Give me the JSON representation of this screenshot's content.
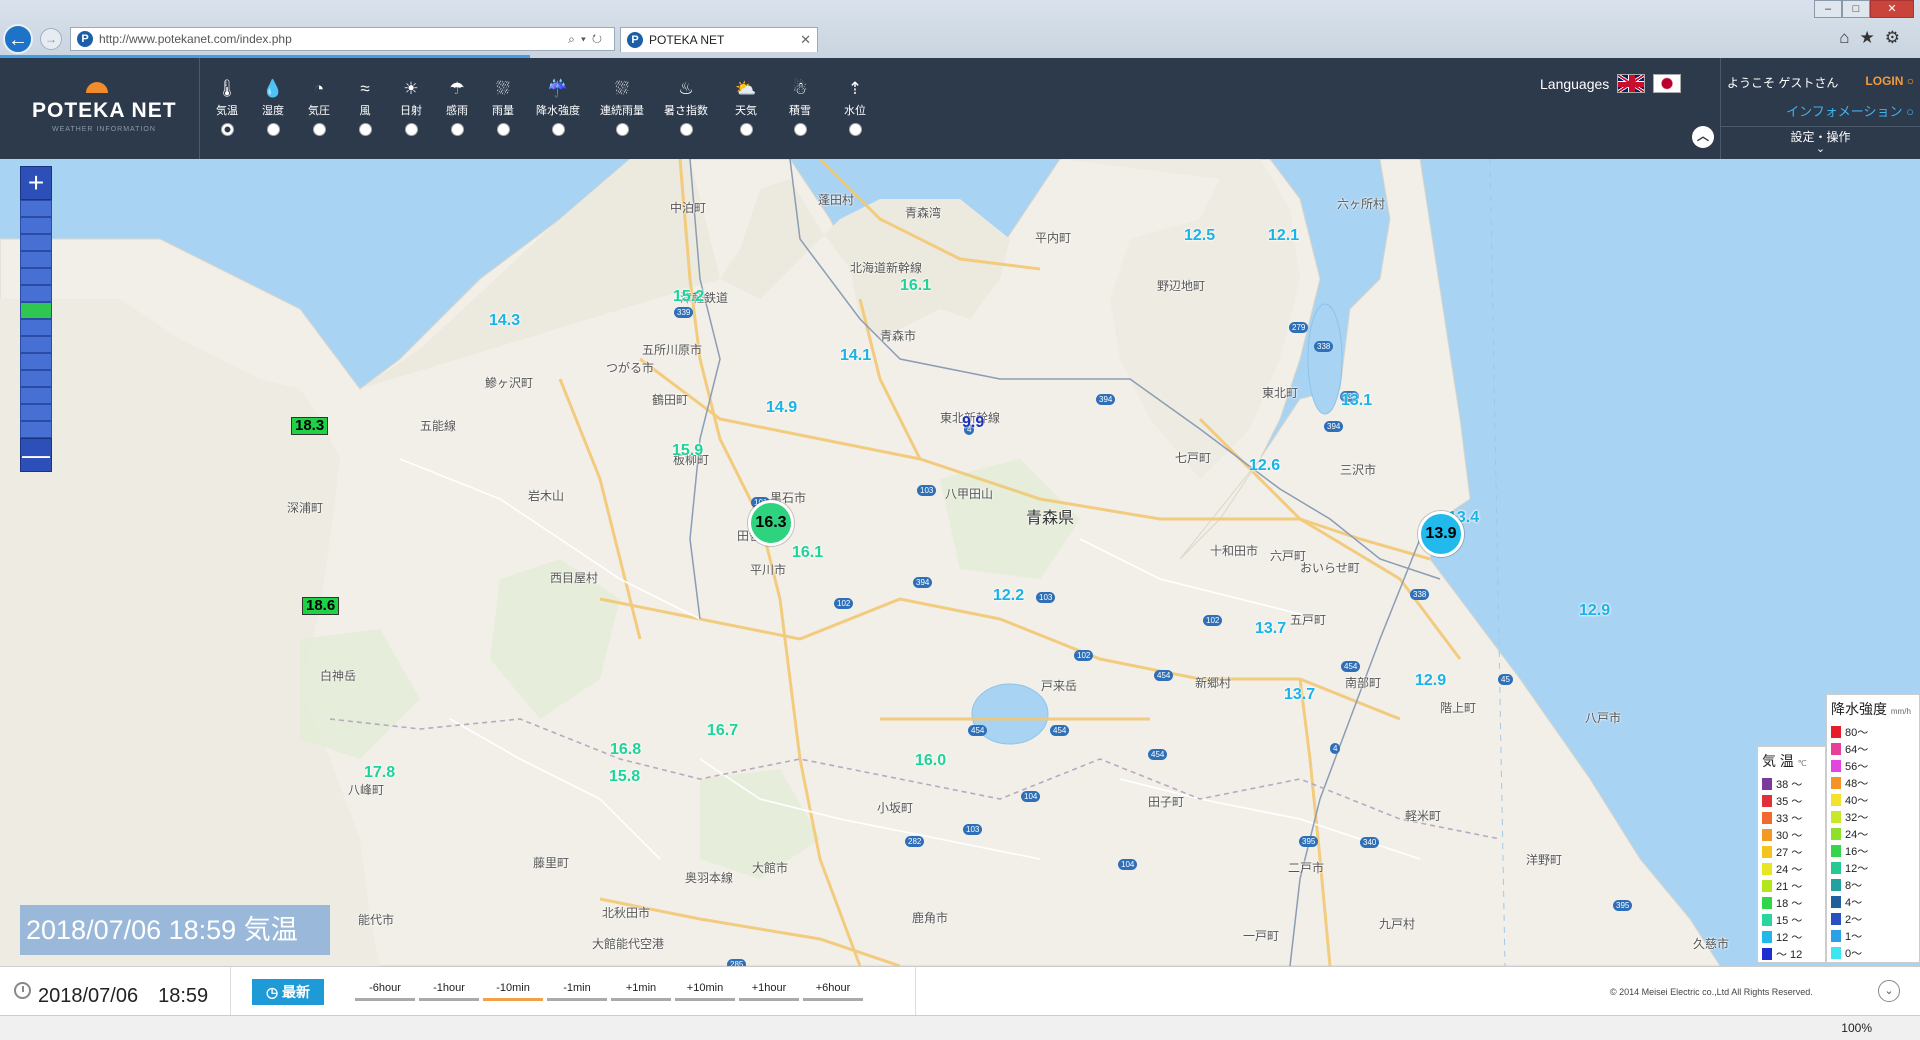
{
  "browser": {
    "url": "http://www.potekanet.com/index.php",
    "tab_title": "POTEKA NET",
    "favicon_letter": "P",
    "zoom_level": "100%"
  },
  "header": {
    "logo_title": "POTEKA NET",
    "logo_subtitle": "WEATHER INFORMATION",
    "layers": [
      {
        "label": "気温",
        "icon": "thermometer-icon",
        "glyph": "🌡",
        "selected": true
      },
      {
        "label": "湿度",
        "icon": "humidity-icon",
        "glyph": "💧",
        "selected": false
      },
      {
        "label": "気圧",
        "icon": "pressure-icon",
        "glyph": "◔",
        "selected": false
      },
      {
        "label": "風",
        "icon": "wind-icon",
        "glyph": "≈",
        "selected": false
      },
      {
        "label": "日射",
        "icon": "sun-icon",
        "glyph": "☀",
        "selected": false
      },
      {
        "label": "感雨",
        "icon": "umbrella-icon",
        "glyph": "☂",
        "selected": false
      },
      {
        "label": "雨量",
        "icon": "rain-gauge-icon",
        "glyph": "⛆",
        "selected": false
      },
      {
        "label": "降水強度",
        "icon": "rain-intensity-icon",
        "glyph": "☔",
        "selected": false
      },
      {
        "label": "連続雨量",
        "icon": "continuous-rain-icon",
        "glyph": "⛆",
        "selected": false
      },
      {
        "label": "暑さ指数",
        "icon": "heat-index-icon",
        "glyph": "♨",
        "selected": false
      },
      {
        "label": "天気",
        "icon": "weather-icon",
        "glyph": "⛅",
        "selected": false
      },
      {
        "label": "積雪",
        "icon": "snowman-icon",
        "glyph": "☃",
        "selected": false
      },
      {
        "label": "水位",
        "icon": "water-level-icon",
        "glyph": "⇡",
        "selected": false
      }
    ],
    "languages_label": "Languages",
    "welcome": "ようこそ ゲストさん",
    "login": "LOGIN",
    "information": "インフォメーション",
    "settings": "設定・操作"
  },
  "map": {
    "prefecture": "青森県",
    "places": [
      {
        "name": "中泊町"
      },
      {
        "name": "蓬田村"
      },
      {
        "name": "平内町"
      },
      {
        "name": "六ヶ所村"
      },
      {
        "name": "野辺地町"
      },
      {
        "name": "五所川原市"
      },
      {
        "name": "つがる市"
      },
      {
        "name": "青森市"
      },
      {
        "name": "鰺ヶ沢町"
      },
      {
        "name": "鶴田町"
      },
      {
        "name": "東北町"
      },
      {
        "name": "板柳町"
      },
      {
        "name": "七戸町"
      },
      {
        "name": "三沢市"
      },
      {
        "name": "岩木山"
      },
      {
        "name": "八甲田山"
      },
      {
        "name": "深浦町"
      },
      {
        "name": "黒石市"
      },
      {
        "name": "田舎館村"
      },
      {
        "name": "十和田市"
      },
      {
        "name": "六戸町"
      },
      {
        "name": "おいらせ町"
      },
      {
        "name": "平川市"
      },
      {
        "name": "西目屋村"
      },
      {
        "name": "五戸町"
      },
      {
        "name": "白神岳"
      },
      {
        "name": "戸来岳"
      },
      {
        "name": "新郷村"
      },
      {
        "name": "南部町"
      },
      {
        "name": "階上町"
      },
      {
        "name": "八戸市"
      },
      {
        "name": "八峰町"
      },
      {
        "name": "田子町"
      },
      {
        "name": "小坂町"
      },
      {
        "name": "軽米町"
      },
      {
        "name": "藤里町"
      },
      {
        "name": "大館市"
      },
      {
        "name": "二戸市"
      },
      {
        "name": "洋野町"
      },
      {
        "name": "能代市"
      },
      {
        "name": "北秋田市"
      },
      {
        "name": "鹿角市"
      },
      {
        "name": "九戸村"
      },
      {
        "name": "一戸町"
      },
      {
        "name": "久慈市"
      },
      {
        "name": "大館能代空港"
      },
      {
        "name": "奥羽本線"
      },
      {
        "name": "五能線"
      },
      {
        "name": "東北新幹線"
      },
      {
        "name": "津軽鉄道"
      },
      {
        "name": "北海道新幹線"
      },
      {
        "name": "青森湾"
      }
    ],
    "readings": [
      {
        "value": "12.5",
        "color": "#1ab3e6"
      },
      {
        "value": "12.1",
        "color": "#1ab3e6"
      },
      {
        "value": "15.2",
        "color": "#1ed39a"
      },
      {
        "value": "16.1",
        "color": "#1ed39a"
      },
      {
        "value": "14.3",
        "color": "#1ab3e6"
      },
      {
        "value": "14.1",
        "color": "#1ab3e6"
      },
      {
        "value": "14.9",
        "color": "#1ab3e6"
      },
      {
        "value": "9.9",
        "color": "#1f2ebf"
      },
      {
        "value": "13.1",
        "color": "#1ab3e6"
      },
      {
        "value": "18.3",
        "color": "#000000",
        "boxed": true
      },
      {
        "value": "15.9",
        "color": "#1ed39a"
      },
      {
        "value": "12.6",
        "color": "#1ab3e6"
      },
      {
        "value": "13.4",
        "color": "#1ab3e6"
      },
      {
        "value": "16.1",
        "color": "#1ed39a"
      },
      {
        "value": "18.6",
        "color": "#000000",
        "boxed": true
      },
      {
        "value": "12.2",
        "color": "#1ab3e6"
      },
      {
        "value": "12.9",
        "color": "#1ab3e6"
      },
      {
        "value": "13.7",
        "color": "#1ab3e6"
      },
      {
        "value": "12.9",
        "color": "#1ab3e6"
      },
      {
        "value": "13.7",
        "color": "#1ab3e6"
      },
      {
        "value": "16.7",
        "color": "#1ed39a"
      },
      {
        "value": "16.8",
        "color": "#1ed39a"
      },
      {
        "value": "15.8",
        "color": "#1ed39a"
      },
      {
        "value": "16.0",
        "color": "#1ed39a"
      },
      {
        "value": "17.8",
        "color": "#1ed39a"
      }
    ],
    "bubbles": [
      {
        "value": "16.3",
        "color": "#2fd27e"
      },
      {
        "value": "13.9",
        "color": "#22b9ec"
      }
    ],
    "datetime_overlay": "2018/07/06 18:59 気温"
  },
  "legend_temp": {
    "title": "気 温",
    "unit": "℃",
    "rows": [
      {
        "label": "38 ～",
        "color": "#7a3a9a"
      },
      {
        "label": "35 ～",
        "color": "#e0303a"
      },
      {
        "label": "33 ～",
        "color": "#ef6a2c"
      },
      {
        "label": "30 ～",
        "color": "#f39a24"
      },
      {
        "label": "27 ～",
        "color": "#f3c51c"
      },
      {
        "label": "24 ～",
        "color": "#e8e623"
      },
      {
        "label": "21 ～",
        "color": "#b5e61d"
      },
      {
        "label": "18 ～",
        "color": "#2fd64a"
      },
      {
        "label": "15 ～",
        "color": "#2ad6a0"
      },
      {
        "label": "12 ～",
        "color": "#22b8ec"
      },
      {
        "label": "～ 12",
        "color": "#1f2ed0"
      }
    ]
  },
  "legend_rain": {
    "title": "降水強度",
    "unit": "mm/h",
    "rows": [
      {
        "label": "80～",
        "color": "#e81d2a"
      },
      {
        "label": "64～",
        "color": "#e8409a"
      },
      {
        "label": "56～",
        "color": "#e444e0"
      },
      {
        "label": "48～",
        "color": "#f3932a"
      },
      {
        "label": "40～",
        "color": "#f3e12a"
      },
      {
        "label": "32～",
        "color": "#c9e82a"
      },
      {
        "label": "24～",
        "color": "#8fe02a"
      },
      {
        "label": "16～",
        "color": "#36d44a"
      },
      {
        "label": "12～",
        "color": "#26c990"
      },
      {
        "label": "8～",
        "color": "#21a2a0"
      },
      {
        "label": "4～",
        "color": "#1f5f9c"
      },
      {
        "label": "2～",
        "color": "#2a4fc0"
      },
      {
        "label": "1～",
        "color": "#2aa0e6"
      },
      {
        "label": "0～",
        "color": "#3ce6f0"
      }
    ]
  },
  "timebar": {
    "datetime": "2018/07/06　18:59",
    "latest": "最新",
    "steps": [
      {
        "label": "-6hour",
        "active": false
      },
      {
        "label": "-1hour",
        "active": false
      },
      {
        "label": "-10min",
        "active": true
      },
      {
        "label": "-1min",
        "active": false
      },
      {
        "label": "+1min",
        "active": false
      },
      {
        "label": "+10min",
        "active": false
      },
      {
        "label": "+1hour",
        "active": false
      },
      {
        "label": "+6hour",
        "active": false
      }
    ],
    "copyright": "© 2014 Meisei Electric co.,Ltd All Rights Reserved."
  }
}
